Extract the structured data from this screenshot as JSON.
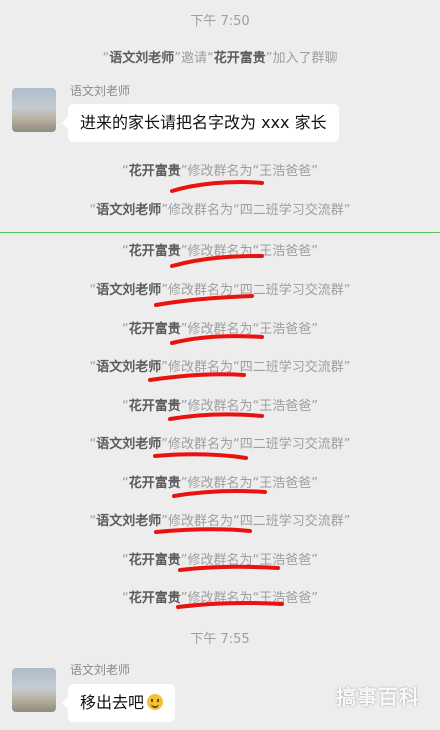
{
  "timestamps": {
    "t1": "下午 7:50",
    "t2": "下午 7:55"
  },
  "join_event": {
    "inviter": "语文刘老师",
    "verb": "邀请",
    "invitee": "花开富贵",
    "suffix": "加入了群聊"
  },
  "messages": [
    {
      "sender": "语文刘老师",
      "text": "进来的家长请把名字改为 xxx 家长"
    },
    {
      "sender": "语文刘老师",
      "text": "移出去吧"
    }
  ],
  "renames": [
    {
      "who": "花开富贵",
      "action": "修改群名为",
      "name": "王浩爸爸"
    },
    {
      "who": "语文刘老师",
      "action": "修改群名为",
      "name": "四二班学习交流群"
    },
    {
      "who": "花开富贵",
      "action": "修改群名为",
      "name": "王浩爸爸"
    },
    {
      "who": "语文刘老师",
      "action": "修改群名为",
      "name": "四二班学习交流群"
    },
    {
      "who": "花开富贵",
      "action": "修改群名为",
      "name": "王浩爸爸"
    },
    {
      "who": "语文刘老师",
      "action": "修改群名为",
      "name": "四二班学习交流群"
    },
    {
      "who": "花开富贵",
      "action": "修改群名为",
      "name": "王浩爸爸"
    },
    {
      "who": "语文刘老师",
      "action": "修改群名为",
      "name": "四二班学习交流群"
    },
    {
      "who": "花开富贵",
      "action": "修改群名为",
      "name": "王浩爸爸"
    },
    {
      "who": "语文刘老师",
      "action": "修改群名为",
      "name": "四二班学习交流群"
    },
    {
      "who": "花开富贵",
      "action": "修改群名为",
      "name": "王浩爸爸"
    },
    {
      "who": "花开富贵",
      "action": "修改群名为",
      "name": "王浩爸爸"
    }
  ],
  "emoji": "smile-emoji",
  "watermark": "搞事百科",
  "colors": {
    "background": "#ededed",
    "bubble": "#ffffff",
    "annotation": "#e8130f",
    "divider": "#4fc25a"
  }
}
